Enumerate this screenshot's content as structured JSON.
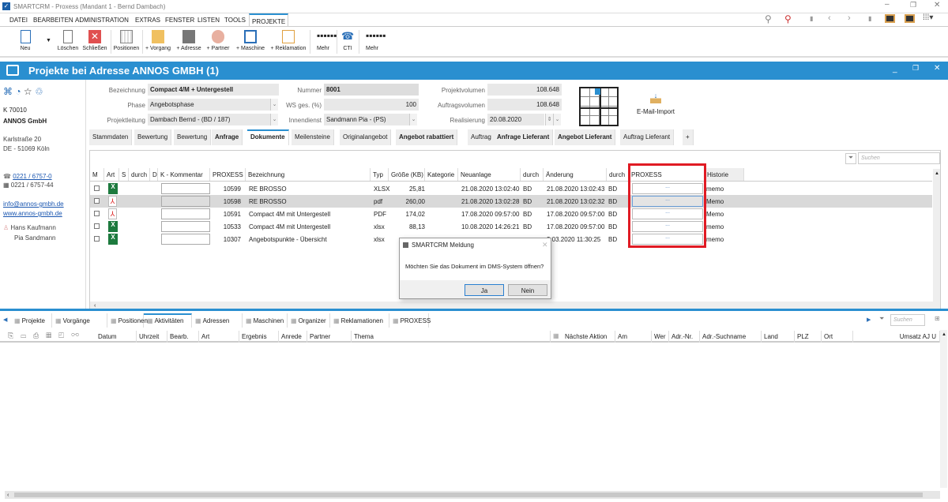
{
  "window": {
    "title": "SMARTCRM - Proxess (Mandant 1 - Bernd Dambach)"
  },
  "menu": [
    "DATEI",
    "BEARBEITEN",
    "ADMINISTRATION",
    "EXTRAS",
    "FENSTER",
    "LISTEN",
    "TOOLS",
    "PROJEKTE"
  ],
  "ribbon": {
    "neu": "Neu",
    "loeschen": "Löschen",
    "schliessen": "Schließen",
    "positionen": "Positionen",
    "vorgang": "+ Vorgang",
    "adresse": "+ Adresse",
    "partner": "+ Partner",
    "maschine": "+ Maschine",
    "reklamation": "+ Reklamation",
    "mehr1": "Mehr",
    "cti": "CTI",
    "mehr2": "Mehr"
  },
  "header": {
    "title": "Projekte bei Adresse ANNOS GMBH (1)"
  },
  "contact": {
    "number": "K 70010",
    "name": "ANNOS GmbH",
    "street": "Karlstraße 20",
    "city": "DE - 51069 Köln",
    "phone": "0221 / 6757-0",
    "fax": "0221 / 6757-44",
    "email": "info@annos-gmbh.de",
    "web": "www.annos-gmbh.de",
    "person1": "Hans Kaufmann",
    "person2": "Pia Sandmann"
  },
  "form": {
    "bezeichnung_label": "Bezeichnung",
    "bezeichnung": "Compact 4/M + Untergestell",
    "phase_label": "Phase",
    "phase": "Angebotsphase",
    "projektleitung_label": "Projektleitung",
    "projektleitung": "Dambach Bernd - (BD / 187)",
    "nummer_label": "Nummer",
    "nummer": "8001",
    "ws_label": "WS ges. (%)",
    "ws": "100",
    "innendienst_label": "Innendienst",
    "innendienst": "Sandmann Pia - (PS)",
    "projektvolumen_label": "Projektvolumen",
    "projektvolumen": "108.648",
    "auftragsvolumen_label": "Auftragsvolumen",
    "auftragsvolumen": "108.648",
    "realisierung_label": "Realisierung",
    "realisierung": "20.08.2020",
    "email_import": "E-Mail-Import"
  },
  "tabs": [
    "Stammdaten",
    "Bewertung",
    "Bewertung",
    "Anfrage",
    "Dokumente",
    "Meilensteine",
    "Originalangebot",
    "Angebot rabattiert",
    "Auftrag",
    "Anfrage Lieferant",
    "Angebot Lieferant",
    "Auftrag Lieferant",
    "+"
  ],
  "grid": {
    "search_placeholder": "Suchen",
    "columns": [
      "M",
      "Art",
      "S",
      "durch",
      "D",
      "K - Kommentar",
      "PROXESS",
      "Bezeichnung",
      "Typ",
      "Größe (KB)",
      "Kategorie",
      "Neuanlage",
      "durch",
      "Änderung",
      "durch",
      "PROXESS",
      "Historie"
    ],
    "rows": [
      {
        "icon": "excel",
        "proxess": "10599",
        "bezeichnung": "RE BROSSO",
        "typ": "XLSX",
        "groesse": "25,81",
        "neuanlage": "21.08.2020 13:02:40",
        "durch1": "BD",
        "aenderung": "21.08.2020 13:02:43",
        "durch2": "BD",
        "btn": "...",
        "historie": "memo",
        "selected": false
      },
      {
        "icon": "pdf",
        "proxess": "10598",
        "bezeichnung": "RE BROSSO",
        "typ": "pdf",
        "groesse": "260,00",
        "neuanlage": "21.08.2020 13:02:28",
        "durch1": "BD",
        "aenderung": "21.08.2020 13:02:32",
        "durch2": "BD",
        "btn": "...",
        "historie": "Memo",
        "selected": true
      },
      {
        "icon": "pdf",
        "proxess": "10591",
        "bezeichnung": "Compact 4M mit Untergestell",
        "typ": "PDF",
        "groesse": "174,02",
        "neuanlage": "17.08.2020 09:57:00",
        "durch1": "BD",
        "aenderung": "17.08.2020 09:57:00",
        "durch2": "BD",
        "btn": "...",
        "historie": "Memo",
        "selected": false
      },
      {
        "icon": "excel",
        "proxess": "10533",
        "bezeichnung": "Compact 4M mit Untergestell",
        "typ": "xlsx",
        "groesse": "88,13",
        "neuanlage": "10.08.2020 14:26:21",
        "durch1": "BD",
        "aenderung": "17.08.2020 09:57:00",
        "durch2": "BD",
        "btn": "...",
        "historie": "memo",
        "selected": false
      },
      {
        "icon": "excel",
        "proxess": "10307",
        "bezeichnung": "Angebotspunkte - Übersicht",
        "typ": "xlsx",
        "groesse": "",
        "neuanlage": "",
        "durch1": "",
        "aenderung": "3.03.2020 11:30:25",
        "durch2": "BD",
        "btn": "...",
        "historie": "memo",
        "selected": false
      }
    ]
  },
  "dialog": {
    "title": "SMARTCRM Meldung",
    "message": "Möchten Sie das Dokument im DMS-System öffnen?",
    "yes": "Ja",
    "no": "Nein"
  },
  "bottom": {
    "tabs": [
      "Projekte",
      "Vorgänge",
      "Positionen",
      "Aktivitäten",
      "Adressen",
      "Maschinen",
      "Organizer",
      "Reklamationen",
      "PROXESS"
    ],
    "search_placeholder": "Suchen",
    "columns": [
      "Datum",
      "Uhrzeit",
      "Bearb.",
      "Art",
      "Ergebnis",
      "Anrede",
      "Partner",
      "Thema",
      "Nächste Aktion",
      "Am",
      "Wer",
      "Adr.-Nr.",
      "Adr.-Suchname",
      "Land",
      "PLZ",
      "Ort",
      "Umsatz AJ U"
    ]
  },
  "colors": {
    "accent": "#2a8fd0",
    "highlight": "#e01b24"
  }
}
